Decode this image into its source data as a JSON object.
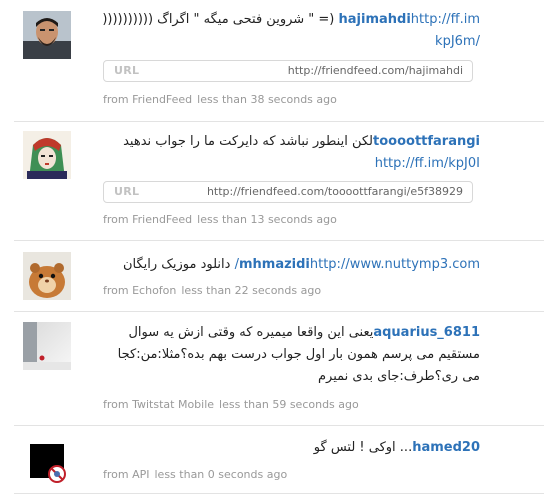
{
  "tweets": [
    {
      "user": "hajimahdi",
      "link_text": "http://ff.im",
      "link_suffix": "/kpJ6m",
      "text": "(= \" شروین فتحی میگه \" اگراگ ((((((((((",
      "url_label": "URL",
      "url_value": "http://friendfeed.com/hajimahdi",
      "source": "from FriendFeed",
      "time": "less than 38 seconds ago"
    },
    {
      "user": "toooottfarangi",
      "user_display": "toooottfarangi",
      "text": "لکن اینطور نباشد که دایرکت ما را جواب ندهید",
      "link_text": "http://ff.im/kpJ0I",
      "url_label": "URL",
      "url_value": "http://friendfeed.com/toooottfarangi/e5f38929",
      "source": "from FriendFeed",
      "time": "less than 13 seconds ago"
    },
    {
      "user": "mhmazidi",
      "text": "دانلود موزیک رایگان",
      "link_text": "http://www.nuttymp3.com/",
      "source": "from Echofon",
      "time": "less than 22 seconds ago"
    },
    {
      "user": "aquarius_6811",
      "text": "یعنی این واقعا میمیره که وقتی ازش یه سوال مستقیم می پرسم همون بار اول جواب درست بهم بده؟مثلا:من:کجا می ری؟طرف:جای بدی نمیرم",
      "source": "from Twitstat Mobile",
      "time": "less than 59 seconds ago"
    },
    {
      "user": "hamed20",
      "text": "... اوکی ! لتس گو",
      "source": "from API",
      "time": "less than 0 seconds ago"
    }
  ]
}
